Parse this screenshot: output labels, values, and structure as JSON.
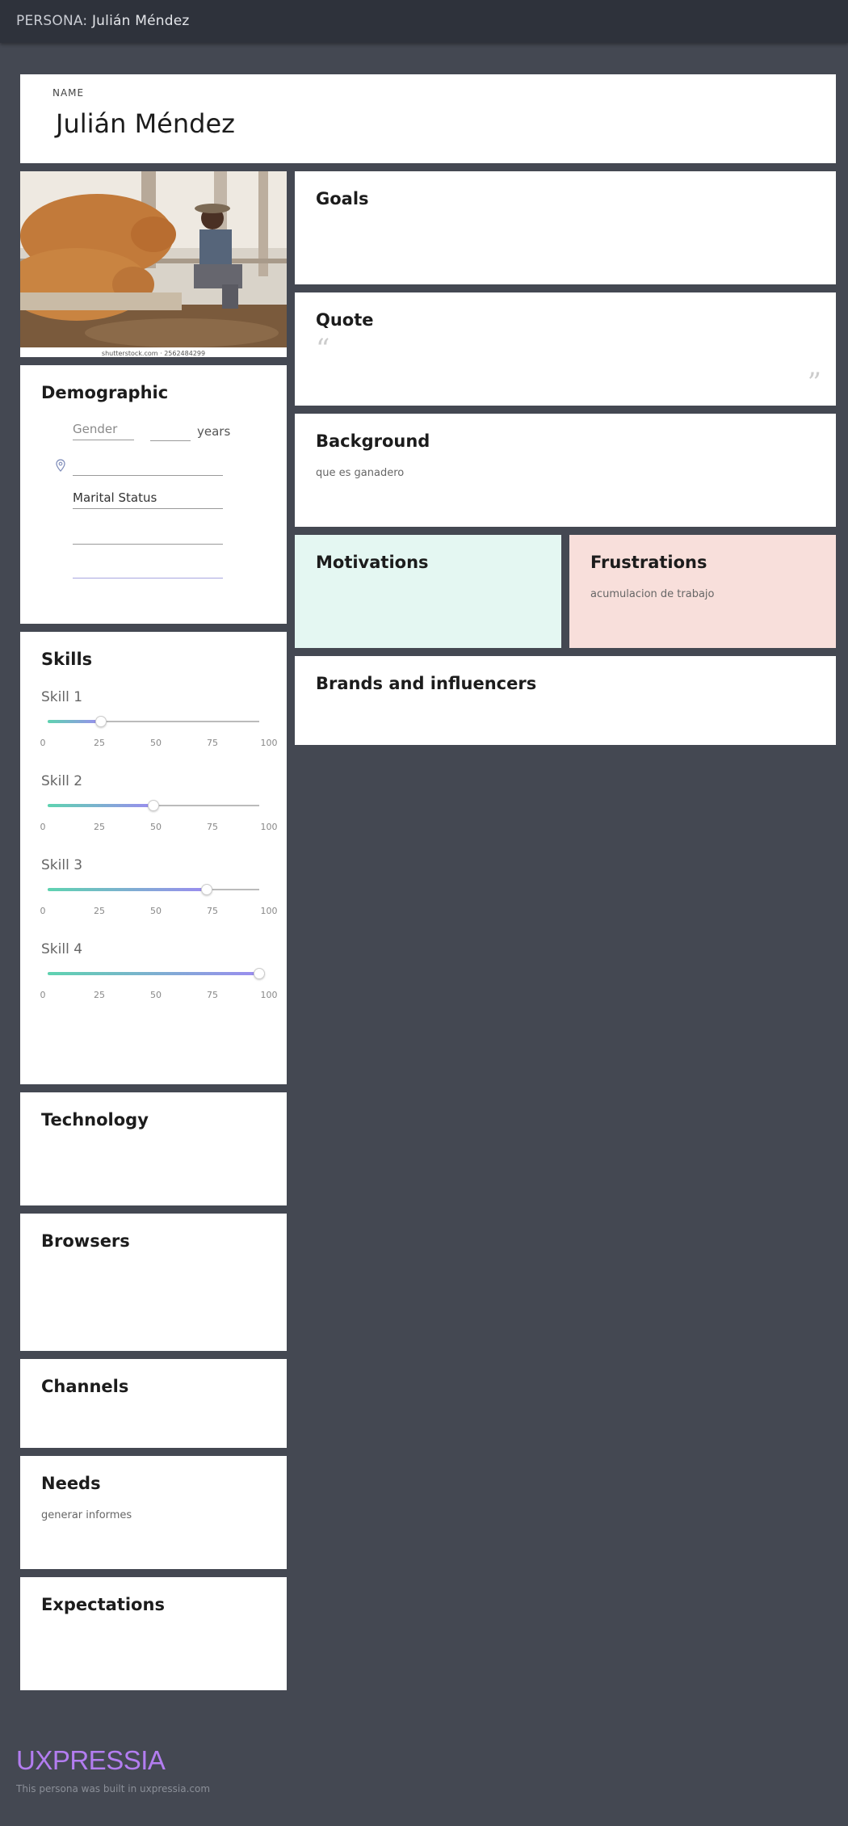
{
  "header": {
    "prefix": "PERSONA:",
    "persona_name": "Julián Méndez"
  },
  "name_card": {
    "label": "NAME",
    "value": "Julián Méndez"
  },
  "photo": {
    "icon": "persona-photo",
    "caption": "shutterstock.com · 2562484299"
  },
  "demographic": {
    "title": "Demographic",
    "gender_placeholder": "Gender",
    "age_value": "",
    "years_label": "years",
    "location_icon": "location-pin-icon",
    "location_value": "",
    "marital_status": "Marital Status",
    "extra_field_1": "",
    "extra_field_2": ""
  },
  "skills": {
    "title": "Skills",
    "tick_labels": [
      "0",
      "25",
      "50",
      "75",
      "100"
    ],
    "items": [
      {
        "name": "Skill 1",
        "value": 25
      },
      {
        "name": "Skill 2",
        "value": 50
      },
      {
        "name": "Skill 3",
        "value": 75
      },
      {
        "name": "Skill 4",
        "value": 100
      }
    ]
  },
  "technology": {
    "title": "Technology"
  },
  "browsers": {
    "title": "Browsers"
  },
  "channels": {
    "title": "Channels"
  },
  "needs": {
    "title": "Needs",
    "text": "generar informes"
  },
  "expectations": {
    "title": "Expectations"
  },
  "goals": {
    "title": "Goals"
  },
  "quote": {
    "title": "Quote",
    "open_mark": "“",
    "close_mark": "”"
  },
  "background": {
    "title": "Background",
    "text": "que es ganadero"
  },
  "motivations": {
    "title": "Motivations",
    "color": "#e4f7f2"
  },
  "frustrations": {
    "title": "Frustrations",
    "text": "acumulacion de trabajo",
    "color": "#f8dfdb"
  },
  "brands": {
    "title": "Brands and influencers"
  },
  "footer": {
    "logo": "UXPRESSIA",
    "note": "This persona was built in uxpressia.com"
  }
}
